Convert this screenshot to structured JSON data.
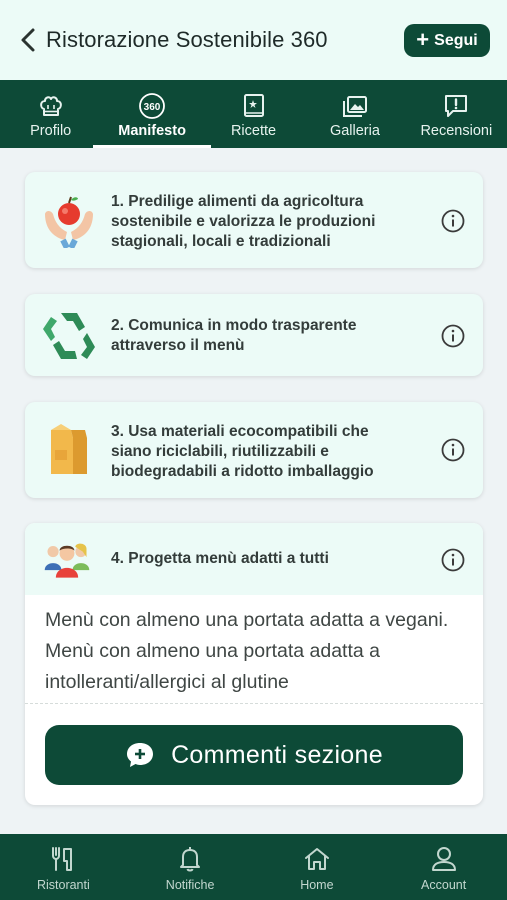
{
  "header": {
    "title": "Ristorazione Sostenibile 360",
    "follow_label": "Segui"
  },
  "tabs": [
    {
      "label": "Profilo",
      "icon": "chef-hat-icon"
    },
    {
      "label": "Manifesto",
      "icon": "badge-360-icon"
    },
    {
      "label": "Ricette",
      "icon": "recipe-book-icon"
    },
    {
      "label": "Galleria",
      "icon": "gallery-icon"
    },
    {
      "label": "Recensioni",
      "icon": "review-icon"
    }
  ],
  "active_tab": "Manifesto",
  "manifesto": [
    {
      "text": "1. Predilige alimenti da agricoltura sostenibile e valorizza le produzioni stagionali, locali e tradizionali",
      "icon": "hands-apple-icon"
    },
    {
      "text": "2. Comunica in modo trasparente attraverso il menù",
      "icon": "recycle-icon"
    },
    {
      "text": "3. Usa materiali ecocompatibili che siano riciclabili, riutilizzabili e biodegradabili a ridotto imballaggio",
      "icon": "paper-bag-icon"
    },
    {
      "text": "4. Progetta menù adatti a tutti",
      "icon": "people-icon",
      "description": "Menù con almeno una portata adatta a vegani. Menù con almeno una portata adatta a intolleranti/allergici al glutine",
      "button_label": "Commenti sezione"
    }
  ],
  "bottom_nav": [
    {
      "label": "Ristoranti",
      "icon": "cutlery-icon"
    },
    {
      "label": "Notifiche",
      "icon": "bell-icon"
    },
    {
      "label": "Home",
      "icon": "home-icon"
    },
    {
      "label": "Account",
      "icon": "account-icon"
    }
  ],
  "colors": {
    "primary": "#0d4a37",
    "card_bg": "#ecfbf7",
    "page_bg": "#eef3f5"
  }
}
